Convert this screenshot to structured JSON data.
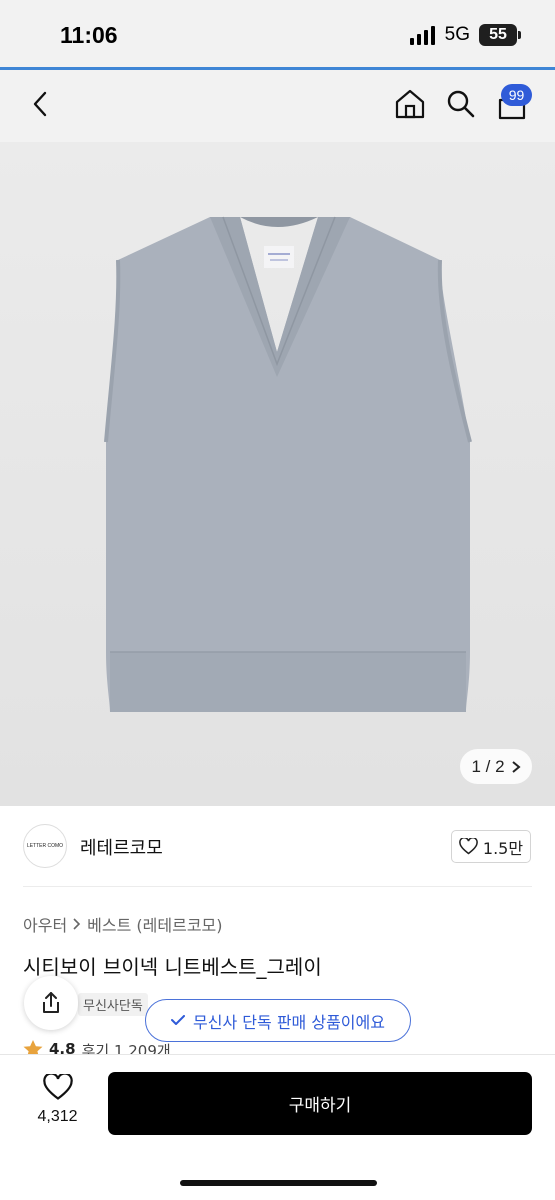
{
  "status": {
    "time": "11:06",
    "network": "5G",
    "battery": "55"
  },
  "nav": {
    "cart_count": "99"
  },
  "gallery": {
    "page": "1 / 2"
  },
  "brand": {
    "logo_text": "LETTER COMO",
    "name": "레테르코모",
    "likes": "1.5만"
  },
  "breadcrumb": {
    "category": "아우터",
    "subcategory": "베스트 (레테르코모)"
  },
  "product": {
    "title": "시티보이 브이넥 니트베스트_그레이",
    "tag": "무신사단독",
    "exclusive_tooltip": "무신사 단독 판매 상품이에요",
    "rating": "4.8",
    "reviews": "후기 1,209개"
  },
  "bottom": {
    "wish_count": "4,312",
    "buy_label": "구매하기"
  },
  "colors": {
    "accent": "#2f5bd8",
    "vest": "#a9b0bb",
    "buy_button": "#000000"
  },
  "icons": [
    "back-icon",
    "home-icon",
    "search-icon",
    "cart-icon",
    "chevron-right-icon",
    "heart-icon",
    "share-icon",
    "check-icon",
    "star-icon"
  ]
}
